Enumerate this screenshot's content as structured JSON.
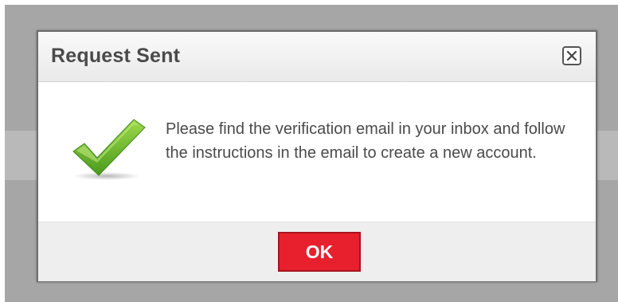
{
  "dialog": {
    "title": "Request Sent",
    "close_icon": "close-icon",
    "status_icon": "checkmark-icon",
    "message": "Please find the verification email in your inbox and follow the instructions in the email to create a new account.",
    "ok_label": "OK"
  },
  "colors": {
    "ok_button": "#e8202d",
    "checkmark": "#6fbf2a"
  }
}
